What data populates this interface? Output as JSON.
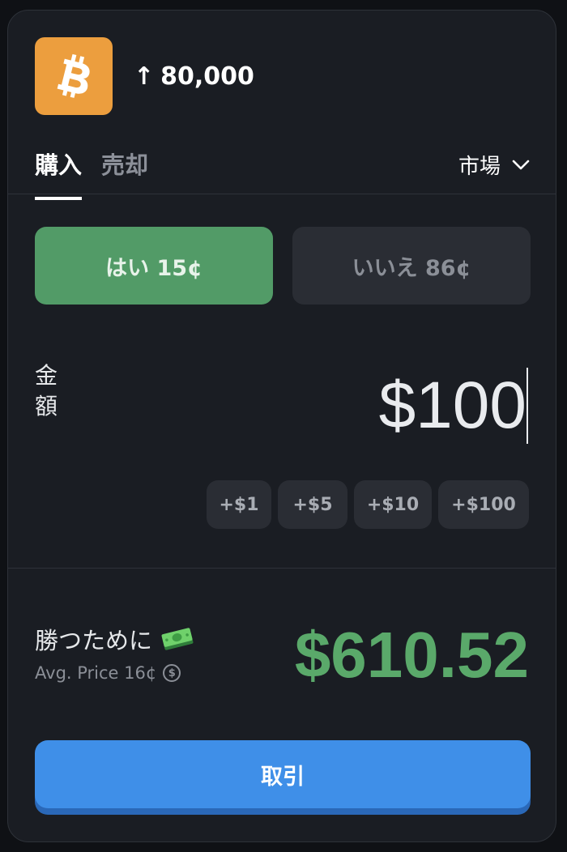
{
  "market": {
    "coin_icon": "bitcoin-icon",
    "arrow": "↑",
    "target": "80,000"
  },
  "tabs": [
    {
      "label": "購入",
      "active": true
    },
    {
      "label": "売却",
      "active": false
    }
  ],
  "order_type": {
    "label": "市場",
    "icon": "chevron-down-icon"
  },
  "outcomes": {
    "yes": {
      "label": "はい 15¢",
      "color": "#529b67"
    },
    "no": {
      "label": "いいえ 86¢",
      "color": "#2a2d34"
    }
  },
  "amount": {
    "label": "金額",
    "value": "$100"
  },
  "quick_add": [
    "+$1",
    "+$5",
    "+$10",
    "+$100"
  ],
  "payout": {
    "label": "勝つために",
    "icon": "money-icon",
    "avg_price": "Avg. Price 16¢",
    "info_icon": "dollar-info-icon",
    "value": "$610.52",
    "color": "#5aa96a"
  },
  "trade_button": {
    "label": "取引",
    "color": "#3f8fe8"
  }
}
